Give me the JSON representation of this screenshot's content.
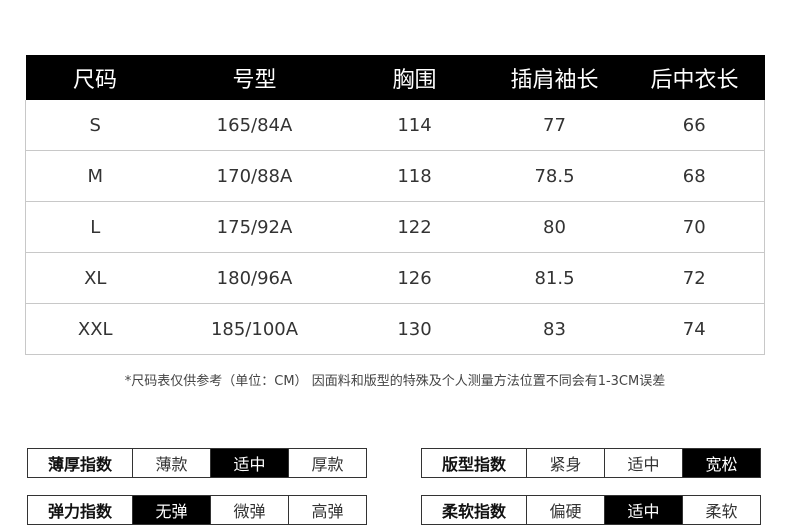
{
  "table": {
    "headers": [
      "尺码",
      "号型",
      "胸围",
      "插肩袖长",
      "后中衣长"
    ],
    "rows": [
      [
        "S",
        "165/84A",
        "114",
        "77",
        "66"
      ],
      [
        "M",
        "170/88A",
        "118",
        "78.5",
        "68"
      ],
      [
        "L",
        "175/92A",
        "122",
        "80",
        "70"
      ],
      [
        "XL",
        "180/96A",
        "126",
        "81.5",
        "72"
      ],
      [
        "XXL",
        "185/100A",
        "130",
        "83",
        "74"
      ]
    ]
  },
  "note": "*尺码表仅供参考（单位：CM） 因面料和版型的特殊及个人测量方法位置不同会有1-3CM误差",
  "indices": [
    {
      "label": "薄厚指数",
      "options": [
        "薄款",
        "适中",
        "厚款"
      ],
      "selected": "适中"
    },
    {
      "label": "版型指数",
      "options": [
        "紧身",
        "适中",
        "宽松"
      ],
      "selected": "宽松"
    },
    {
      "label": "弹力指数",
      "options": [
        "无弹",
        "微弹",
        "高弹"
      ],
      "selected": "无弹"
    },
    {
      "label": "柔软指数",
      "options": [
        "偏硬",
        "适中",
        "柔软"
      ],
      "selected": "适中"
    }
  ]
}
